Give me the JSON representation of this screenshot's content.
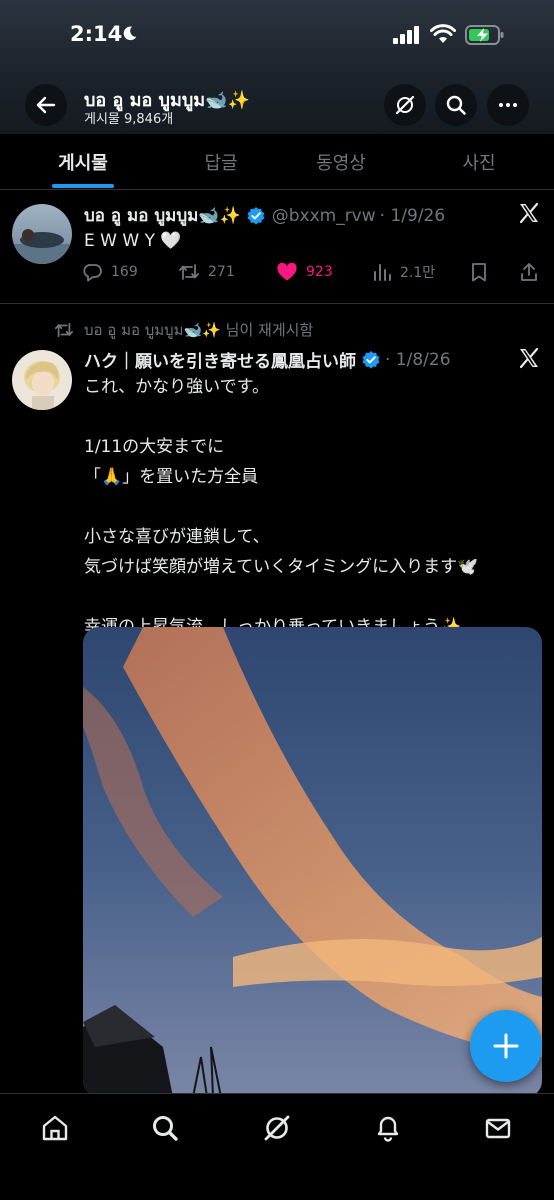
{
  "status_bar": {
    "time": "2:14"
  },
  "profile": {
    "name": "บอ อู มอ บูมบูม🐋✨",
    "post_count": "게시물 9,846개"
  },
  "tabs": [
    {
      "label": "게시물"
    },
    {
      "label": "답글"
    },
    {
      "label": "동영상"
    },
    {
      "label": "사진"
    }
  ],
  "tweet1": {
    "name": "บอ อู มอ บูมบูม🐋✨",
    "handle": "@bxxm_rvw",
    "date": "· 1/9/26",
    "text": "E W W Y 🤍",
    "replies": "169",
    "reposts": "271",
    "likes": "923",
    "views": "2.1만"
  },
  "tweet2": {
    "reposted_by": "บอ อู มอ บูมบูม🐋✨ 님이 재게시함",
    "name": "ハク｜願いを引き寄せる鳳凰占い師",
    "date": "· 1/8/26",
    "text": "これ、かなり強いです。\n\n1/11の大安までに\n「🙏」を置いた方全員\n\n小さな喜びが連鎖して、\n気づけば笑顔が増えていくタイミングに入ります🕊️\n\n幸運の上昇気流、しっかり乗っていきましょう✨"
  },
  "colors": {
    "accent": "#1d9bf0",
    "like": "#f91880",
    "muted": "#71767b",
    "text": "#e7e9ea",
    "background": "#000000"
  },
  "icons": [
    "back-arrow-icon",
    "grok-icon",
    "search-icon",
    "more-icon",
    "x-logo-icon",
    "reply-icon",
    "repost-icon",
    "heart-icon",
    "views-icon",
    "bookmark-icon",
    "share-icon",
    "compose-icon",
    "home-icon",
    "bell-icon",
    "mail-icon"
  ]
}
